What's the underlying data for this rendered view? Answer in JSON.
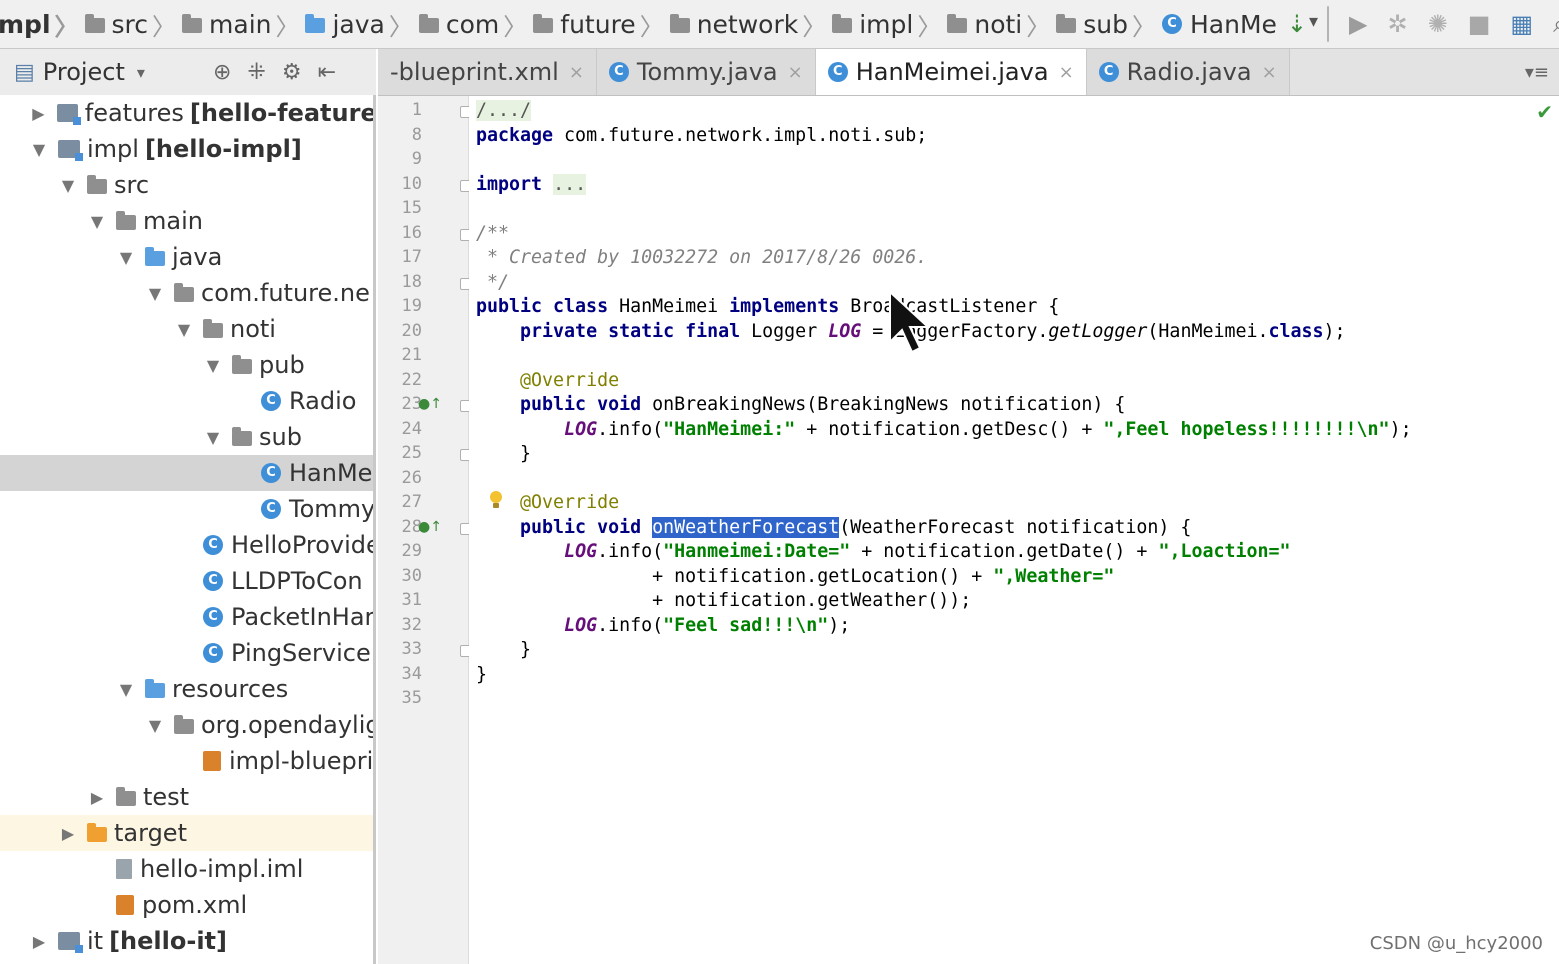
{
  "breadcrumb": [
    {
      "label": "mpl",
      "icon": "none"
    },
    {
      "label": "src",
      "icon": "folder-icon"
    },
    {
      "label": "main",
      "icon": "folder-icon"
    },
    {
      "label": "java",
      "icon": "folder-blue-icon"
    },
    {
      "label": "com",
      "icon": "package-icon"
    },
    {
      "label": "future",
      "icon": "package-icon"
    },
    {
      "label": "network",
      "icon": "package-icon"
    },
    {
      "label": "impl",
      "icon": "package-icon"
    },
    {
      "label": "noti",
      "icon": "package-icon"
    },
    {
      "label": "sub",
      "icon": "package-icon"
    },
    {
      "label": "HanMe",
      "icon": "class-icon"
    }
  ],
  "project_panel": {
    "title": "Project",
    "tree": [
      {
        "label": "features",
        "bold": "[hello-features-",
        "depth": 0,
        "arrow": "▶",
        "icon": "module"
      },
      {
        "label": "impl",
        "bold": "[hello-impl]",
        "depth": 0,
        "arrow": "▼",
        "icon": "module"
      },
      {
        "label": "src",
        "depth": 1,
        "arrow": "▼",
        "icon": "folder"
      },
      {
        "label": "main",
        "depth": 2,
        "arrow": "▼",
        "icon": "folder"
      },
      {
        "label": "java",
        "depth": 3,
        "arrow": "▼",
        "icon": "folder-blue"
      },
      {
        "label": "com.future.ne",
        "depth": 4,
        "arrow": "▼",
        "icon": "folder"
      },
      {
        "label": "noti",
        "depth": 5,
        "arrow": "▼",
        "icon": "folder"
      },
      {
        "label": "pub",
        "depth": 6,
        "arrow": "▼",
        "icon": "folder"
      },
      {
        "label": "Radio",
        "depth": 7,
        "arrow": "",
        "icon": "class"
      },
      {
        "label": "sub",
        "depth": 6,
        "arrow": "▼",
        "icon": "folder"
      },
      {
        "label": "HanMe",
        "depth": 7,
        "arrow": "",
        "icon": "class",
        "selected": true
      },
      {
        "label": "Tommy",
        "depth": 7,
        "arrow": "",
        "icon": "class"
      },
      {
        "label": "HelloProvider",
        "depth": 5,
        "arrow": "",
        "icon": "class"
      },
      {
        "label": "LLDPToCon",
        "depth": 5,
        "arrow": "",
        "icon": "class"
      },
      {
        "label": "PacketInHar",
        "depth": 5,
        "arrow": "",
        "icon": "class"
      },
      {
        "label": "PingServicel",
        "depth": 5,
        "arrow": "",
        "icon": "class"
      },
      {
        "label": "resources",
        "depth": 3,
        "arrow": "▼",
        "icon": "folder-blue"
      },
      {
        "label": "org.opendaylig",
        "depth": 4,
        "arrow": "▼",
        "icon": "folder"
      },
      {
        "label": "impl-bluepri",
        "depth": 5,
        "arrow": "",
        "icon": "xml"
      },
      {
        "label": "test",
        "depth": 2,
        "arrow": "▶",
        "icon": "folder"
      },
      {
        "label": "target",
        "depth": 1,
        "arrow": "▶",
        "icon": "folder-orange",
        "highlight": true
      },
      {
        "label": "hello-impl.iml",
        "depth": 2,
        "arrow": "",
        "icon": "file"
      },
      {
        "label": "pom.xml",
        "depth": 2,
        "arrow": "",
        "icon": "xml"
      },
      {
        "label": "it",
        "bold": "[hello-it]",
        "depth": 0,
        "arrow": "▶",
        "icon": "module"
      }
    ]
  },
  "tabs": [
    {
      "label": "-blueprint.xml",
      "icon": "none",
      "active": false
    },
    {
      "label": "Tommy.java",
      "icon": "class",
      "active": false
    },
    {
      "label": "HanMeimei.java",
      "icon": "class",
      "active": true
    },
    {
      "label": "Radio.java",
      "icon": "class",
      "active": false
    }
  ],
  "editor": {
    "line_numbers": [
      "1",
      "8",
      "9",
      "10",
      "15",
      "16",
      "17",
      "18",
      "19",
      "20",
      "21",
      "22",
      "23",
      "24",
      "25",
      "26",
      "27",
      "28",
      "29",
      "30",
      "31",
      "32",
      "33",
      "34",
      "35"
    ],
    "lines": [
      [
        {
          "t": "/.../",
          "c": "fold"
        }
      ],
      [
        {
          "t": "package",
          "c": "kw"
        },
        {
          "t": " com.future.network.impl.noti.sub;",
          "c": ""
        }
      ],
      [],
      [
        {
          "t": "import",
          "c": "kw"
        },
        {
          "t": " ",
          "c": ""
        },
        {
          "t": "...",
          "c": "fold"
        }
      ],
      [],
      [
        {
          "t": "/**",
          "c": "cm"
        }
      ],
      [
        {
          "t": " * Created by 10032272 on 2017/8/26 0026.",
          "c": "cm"
        }
      ],
      [
        {
          "t": " */",
          "c": "cm"
        }
      ],
      [
        {
          "t": "public class",
          "c": "kw"
        },
        {
          "t": " HanMeimei ",
          "c": ""
        },
        {
          "t": "implements",
          "c": "kw"
        },
        {
          "t": " BroadcastListener {",
          "c": ""
        }
      ],
      [
        {
          "t": "    ",
          "c": ""
        },
        {
          "t": "private static final",
          "c": "kw"
        },
        {
          "t": " Logger ",
          "c": ""
        },
        {
          "t": "LOG",
          "c": "fld"
        },
        {
          "t": " = LoggerFactory.",
          "c": ""
        },
        {
          "t": "getLogger",
          "c": "it"
        },
        {
          "t": "(HanMeimei.",
          "c": ""
        },
        {
          "t": "class",
          "c": "kw"
        },
        {
          "t": ");",
          "c": ""
        }
      ],
      [],
      [
        {
          "t": "    ",
          "c": ""
        },
        {
          "t": "@Override",
          "c": "ann"
        }
      ],
      [
        {
          "t": "    ",
          "c": ""
        },
        {
          "t": "public void",
          "c": "kw"
        },
        {
          "t": " onBreakingNews(BreakingNews notification) {",
          "c": ""
        }
      ],
      [
        {
          "t": "        ",
          "c": ""
        },
        {
          "t": "LOG",
          "c": "fld"
        },
        {
          "t": ".info(",
          "c": ""
        },
        {
          "t": "\"HanMeimei:\"",
          "c": "str"
        },
        {
          "t": " + notification.getDesc() + ",
          "c": ""
        },
        {
          "t": "\",Feel hopeless!!!!!!!!\\n\"",
          "c": "str"
        },
        {
          "t": ");",
          "c": ""
        }
      ],
      [
        {
          "t": "    }",
          "c": ""
        }
      ],
      [],
      [
        {
          "t": "    ",
          "c": ""
        },
        {
          "t": "@Override",
          "c": "ann"
        }
      ],
      [
        {
          "t": "    ",
          "c": ""
        },
        {
          "t": "public void",
          "c": "kw"
        },
        {
          "t": " ",
          "c": ""
        },
        {
          "t": "onWeatherForecast",
          "c": "sel"
        },
        {
          "t": "(WeatherForecast notification) {",
          "c": ""
        }
      ],
      [
        {
          "t": "        ",
          "c": ""
        },
        {
          "t": "LOG",
          "c": "fld"
        },
        {
          "t": ".info(",
          "c": ""
        },
        {
          "t": "\"Hanmeimei:Date=\"",
          "c": "str"
        },
        {
          "t": " + notification.getDate() + ",
          "c": ""
        },
        {
          "t": "\",Loaction=\"",
          "c": "str"
        }
      ],
      [
        {
          "t": "                + notification.getLocation() + ",
          "c": ""
        },
        {
          "t": "\",Weather=\"",
          "c": "str"
        }
      ],
      [
        {
          "t": "                + notification.getWeather());",
          "c": ""
        }
      ],
      [
        {
          "t": "        ",
          "c": ""
        },
        {
          "t": "LOG",
          "c": "fld"
        },
        {
          "t": ".info(",
          "c": ""
        },
        {
          "t": "\"Feel sad!!!\\n\"",
          "c": "str"
        },
        {
          "t": ");",
          "c": ""
        }
      ],
      [
        {
          "t": "    }",
          "c": ""
        }
      ],
      [
        {
          "t": "}",
          "c": ""
        }
      ],
      []
    ]
  },
  "watermark": "CSDN @u_hcy2000"
}
